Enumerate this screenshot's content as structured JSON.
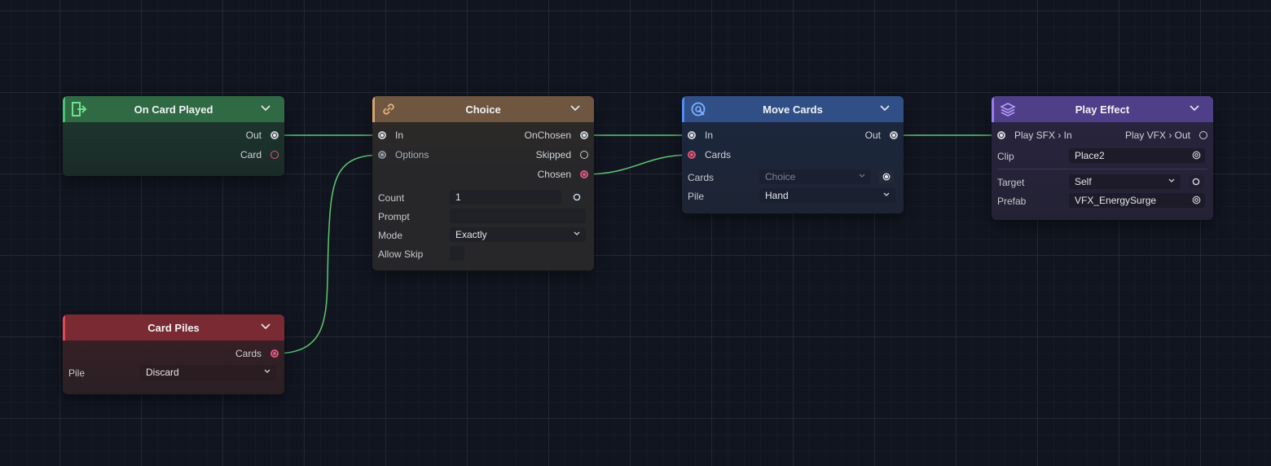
{
  "colors": {
    "canvas": "#111520",
    "wire": "#5fc96f",
    "event_header": "#2f6a44",
    "choice_header": "#6e5640",
    "move_header": "#2f4f86",
    "effect_header": "#4f3f88",
    "piles_header": "#7a2a32",
    "pink_port": "#e0557a"
  },
  "nodes": {
    "on_card_played": {
      "title": "On Card Played",
      "icon": "door-exit-icon",
      "outputs": [
        "Out",
        "Card"
      ]
    },
    "card_piles": {
      "title": "Card Piles",
      "outputs": [
        "Cards"
      ],
      "pile_label": "Pile",
      "pile_value": "Discard"
    },
    "choice": {
      "title": "Choice",
      "icon": "link-icon",
      "inputs": [
        "In",
        "Options"
      ],
      "outputs": [
        "OnChosen",
        "Skipped",
        "Chosen"
      ],
      "count_label": "Count",
      "count_value": "1",
      "prompt_label": "Prompt",
      "prompt_value": "",
      "mode_label": "Mode",
      "mode_value": "Exactly",
      "allow_skip_label": "Allow Skip"
    },
    "move_cards": {
      "title": "Move Cards",
      "icon": "cursor-target-icon",
      "inputs": [
        "In",
        "Cards"
      ],
      "outputs": [
        "Out"
      ],
      "cards_label": "Cards",
      "cards_value": "Choice",
      "pile_label": "Pile",
      "pile_value": "Hand"
    },
    "play_effect": {
      "title": "Play Effect",
      "icon": "layers-icon",
      "inputs": [
        "Play SFX › In"
      ],
      "outputs": [
        "Play VFX › Out"
      ],
      "clip_label": "Clip",
      "clip_value": "Place2",
      "target_label": "Target",
      "target_value": "Self",
      "prefab_label": "Prefab",
      "prefab_value": "VFX_EnergySurge"
    }
  }
}
